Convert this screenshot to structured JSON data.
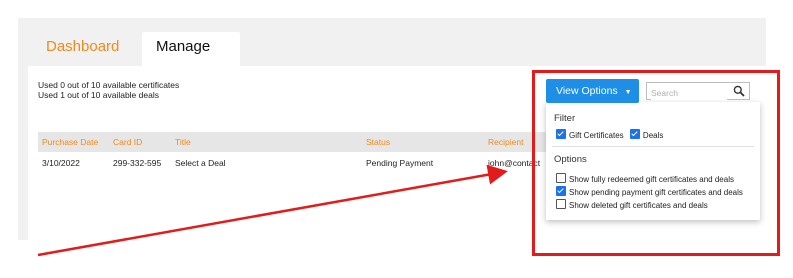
{
  "tabs": [
    {
      "label": "Dashboard",
      "active": false,
      "color": "#f08a1c"
    },
    {
      "label": "Manage",
      "active": true
    }
  ],
  "usage": {
    "certificates": "Used 0 out of 10 available certificates",
    "deals": "Used 1 out of 10 available deals"
  },
  "table": {
    "columns": [
      "Purchase Date",
      "Card ID",
      "Title",
      "Status",
      "Recipient"
    ],
    "rows": [
      {
        "purchase_date": "3/10/2022",
        "card_id": "299-332-595",
        "title": "Select a Deal",
        "status": "Pending Payment",
        "recipient": "john@contact"
      }
    ]
  },
  "view_options": {
    "button_label": "View Options",
    "caret": "▼",
    "search_placeholder": "Search",
    "filter": {
      "title": "Filter",
      "gift_certificates": {
        "label": "Gift Certificates",
        "checked": true
      },
      "deals": {
        "label": "Deals",
        "checked": true
      }
    },
    "options": {
      "title": "Options",
      "items": [
        {
          "label": "Show fully redeemed gift certificates and deals",
          "checked": false
        },
        {
          "label": "Show pending payment gift certificates and deals",
          "checked": true
        },
        {
          "label": "Show deleted gift certificates and deals",
          "checked": false
        }
      ]
    }
  },
  "annotation": {
    "highlight_color": "#e31b1b",
    "arrow_color": "#e31b1b"
  },
  "colors": {
    "accent": "#f08a1c",
    "button": "#1e8ee6",
    "check": "#1a73e8"
  }
}
